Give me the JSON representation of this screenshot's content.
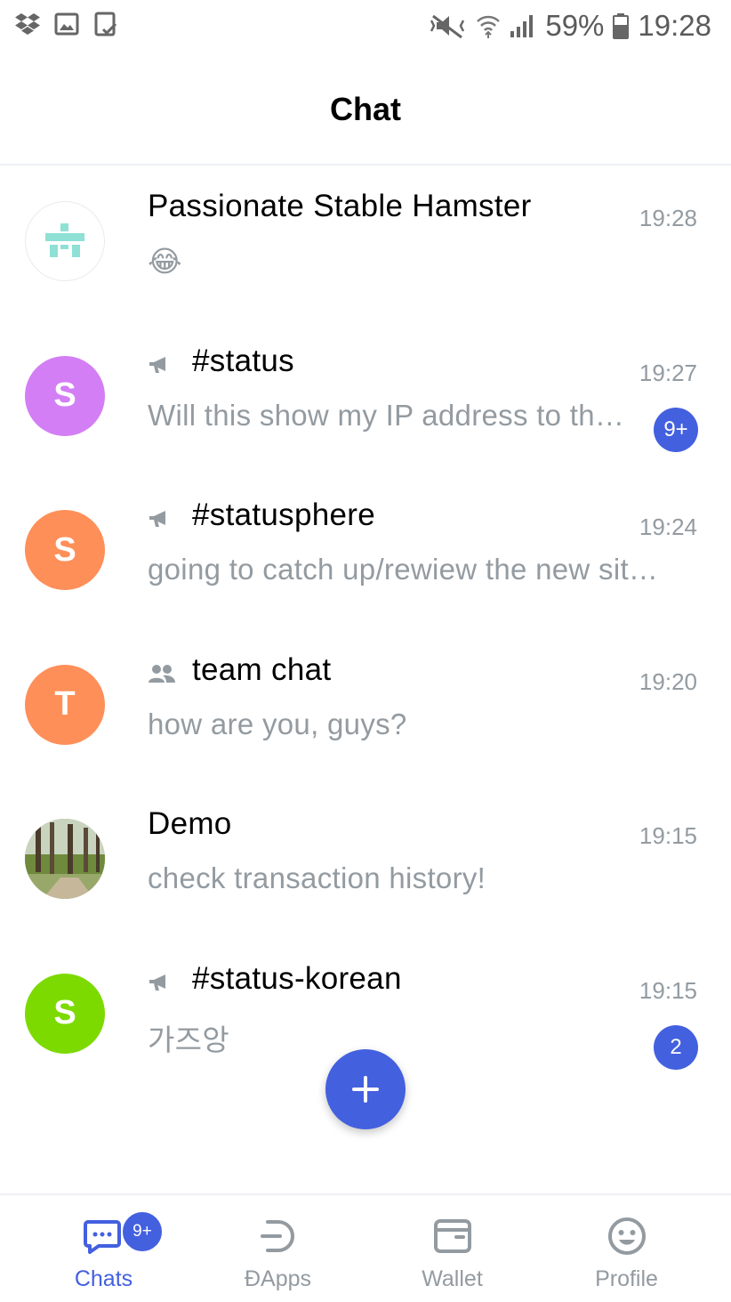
{
  "status_bar": {
    "battery_text": "59%",
    "time": "19:28",
    "left_icons": [
      "dropbox-icon",
      "gallery-icon",
      "clipboard-check-icon"
    ],
    "right_icons": [
      "mute-icon",
      "wifi-icon",
      "signal-icon",
      "battery-icon"
    ]
  },
  "header": {
    "title": "Chat"
  },
  "colors": {
    "accent": "#4360df",
    "muted": "#939ba1"
  },
  "chats": [
    {
      "name": "Passionate Stable Hamster",
      "time": "19:28",
      "message": "😂",
      "type": "direct",
      "avatar_kind": "identicon"
    },
    {
      "name": "#status",
      "time": "19:27",
      "message": "Will this show my IP address to th…",
      "type": "public",
      "avatar_letter": "S",
      "avatar_color": "#d37ef4",
      "unread": "9+"
    },
    {
      "name": "#statusphere",
      "time": "19:24",
      "message": "going to catch up/rewiew the new sit…",
      "type": "public",
      "avatar_letter": "S",
      "avatar_color": "#fe8f59"
    },
    {
      "name": "team chat",
      "time": "19:20",
      "message": "how are you, guys?",
      "type": "group",
      "avatar_letter": "T",
      "avatar_color": "#fe8f59"
    },
    {
      "name": "Demo",
      "time": "19:15",
      "message": "check transaction history!",
      "type": "direct",
      "avatar_kind": "photo"
    },
    {
      "name": "#status-korean",
      "time": "19:15",
      "message": "가즈앙",
      "type": "public",
      "avatar_letter": "S",
      "avatar_color": "#7cda00",
      "unread": "2"
    }
  ],
  "fab": {
    "icon": "plus-icon"
  },
  "tabs": [
    {
      "label": "Chats",
      "icon": "chat-bubble-icon",
      "active": true,
      "badge": "9+"
    },
    {
      "label": "ĐApps",
      "icon": "dapps-icon",
      "active": false
    },
    {
      "label": "Wallet",
      "icon": "wallet-icon",
      "active": false
    },
    {
      "label": "Profile",
      "icon": "smiley-icon",
      "active": false
    }
  ]
}
